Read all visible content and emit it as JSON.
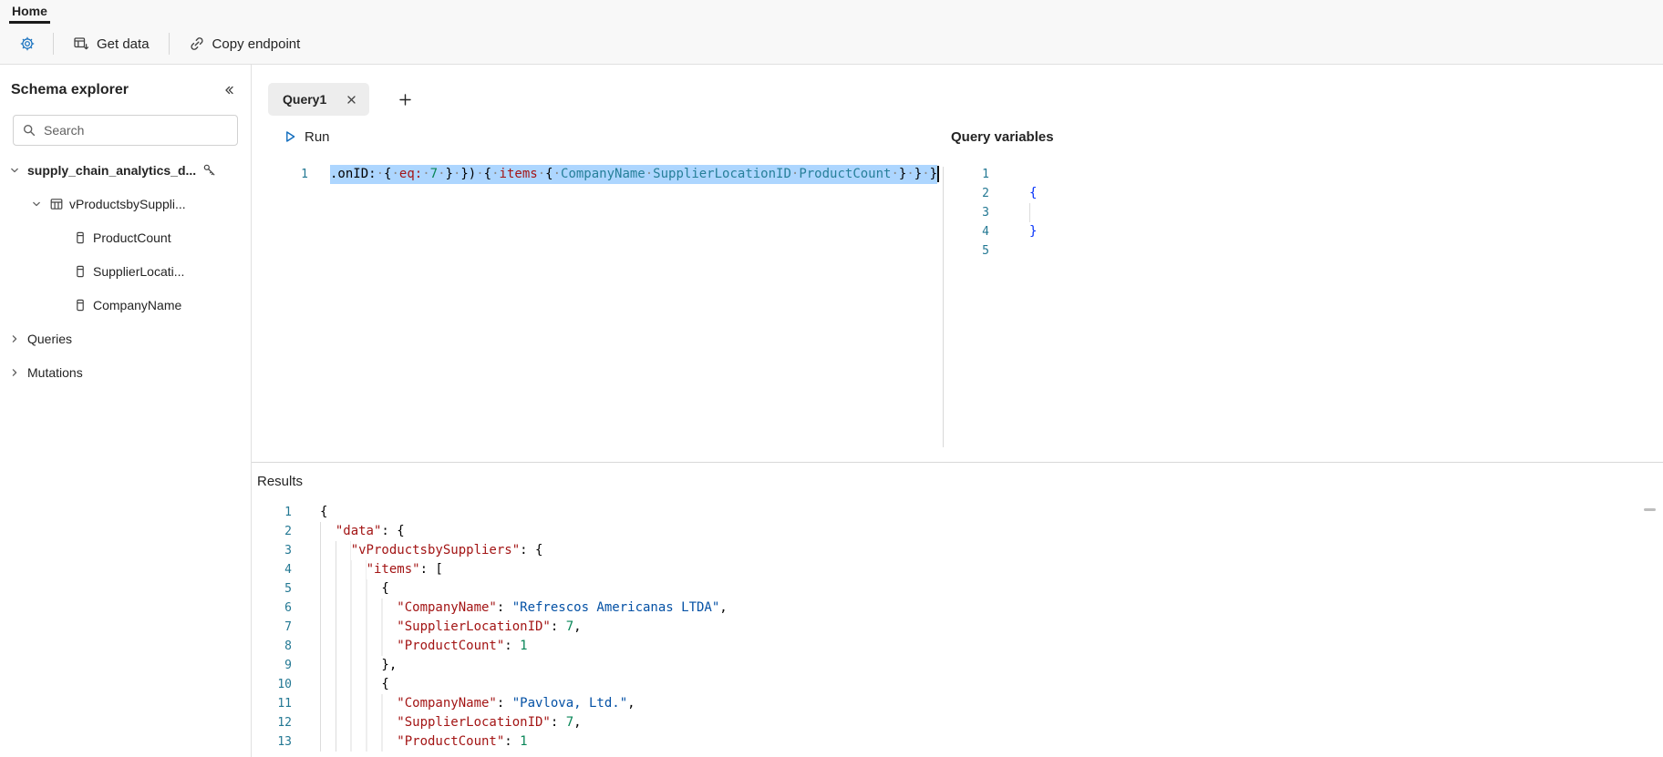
{
  "colors": {
    "accent": "#0f6cbd",
    "selection": "#add6ff",
    "gutter": "#237893",
    "token_key": "#a31515",
    "token_string": "#0451a5",
    "token_number": "#098658",
    "token_field": "#267f99",
    "token_brace": "#0431fa"
  },
  "topbar": {
    "home": "Home"
  },
  "toolbar": {
    "get_data": "Get data",
    "copy_endpoint": "Copy endpoint"
  },
  "sidebar": {
    "title": "Schema explorer",
    "search_placeholder": "Search",
    "tree": [
      {
        "label": "supply_chain_analytics_d...",
        "level": 0,
        "chevron": "down",
        "icon": "none",
        "trailing_icon": "key",
        "bold": true
      },
      {
        "label": "vProductsbySuppli...",
        "level": 1,
        "chevron": "down",
        "icon": "table"
      },
      {
        "label": "ProductCount",
        "level": 2,
        "chevron": "none",
        "icon": "column"
      },
      {
        "label": "SupplierLocati...",
        "level": 2,
        "chevron": "none",
        "icon": "column"
      },
      {
        "label": "CompanyName",
        "level": 2,
        "chevron": "none",
        "icon": "column"
      },
      {
        "label": "Queries",
        "level": 0,
        "chevron": "right",
        "icon": "none"
      },
      {
        "label": "Mutations",
        "level": 0,
        "chevron": "right",
        "icon": "none"
      }
    ]
  },
  "editor": {
    "tab_label": "Query1",
    "run_label": "Run",
    "code": {
      "line_number": 1,
      "tokens": [
        {
          "c": "plain",
          "v": ".onID:"
        },
        {
          "c": "ws",
          "v": " "
        },
        {
          "c": "punct",
          "v": "{"
        },
        {
          "c": "ws",
          "v": " "
        },
        {
          "c": "key",
          "v": "eq:"
        },
        {
          "c": "ws",
          "v": " "
        },
        {
          "c": "num",
          "v": "7"
        },
        {
          "c": "ws",
          "v": " "
        },
        {
          "c": "punct",
          "v": "}"
        },
        {
          "c": "ws",
          "v": " "
        },
        {
          "c": "punct",
          "v": "})"
        },
        {
          "c": "ws",
          "v": " "
        },
        {
          "c": "punct",
          "v": "{"
        },
        {
          "c": "ws",
          "v": " "
        },
        {
          "c": "key",
          "v": "items"
        },
        {
          "c": "ws",
          "v": " "
        },
        {
          "c": "punct",
          "v": "{"
        },
        {
          "c": "ws",
          "v": " "
        },
        {
          "c": "field",
          "v": "CompanyName"
        },
        {
          "c": "ws",
          "v": " "
        },
        {
          "c": "field",
          "v": "SupplierLocationID"
        },
        {
          "c": "ws",
          "v": " "
        },
        {
          "c": "field",
          "v": "ProductCount"
        },
        {
          "c": "ws",
          "v": " "
        },
        {
          "c": "punct",
          "v": "}"
        },
        {
          "c": "ws",
          "v": " "
        },
        {
          "c": "punct",
          "v": "}"
        },
        {
          "c": "ws",
          "v": " "
        },
        {
          "c": "punct",
          "v": "}"
        }
      ]
    },
    "variables": {
      "title": "Query variables",
      "lines": [
        {
          "n": 1,
          "text": ""
        },
        {
          "n": 2,
          "text": "{"
        },
        {
          "n": 3,
          "text": "",
          "guide": true
        },
        {
          "n": 4,
          "text": "}"
        },
        {
          "n": 5,
          "text": ""
        }
      ]
    }
  },
  "results": {
    "title": "Results",
    "lines": [
      {
        "n": 1,
        "indent": 0,
        "tokens": [
          {
            "c": "punct",
            "v": "{"
          }
        ]
      },
      {
        "n": 2,
        "indent": 2,
        "tokens": [
          {
            "c": "key",
            "v": "\"data\""
          },
          {
            "c": "punct",
            "v": ": {"
          }
        ]
      },
      {
        "n": 3,
        "indent": 4,
        "tokens": [
          {
            "c": "key",
            "v": "\"vProductsbySuppliers\""
          },
          {
            "c": "punct",
            "v": ": {"
          }
        ]
      },
      {
        "n": 4,
        "indent": 6,
        "tokens": [
          {
            "c": "key",
            "v": "\"items\""
          },
          {
            "c": "punct",
            "v": ": ["
          }
        ]
      },
      {
        "n": 5,
        "indent": 8,
        "tokens": [
          {
            "c": "punct",
            "v": "{"
          }
        ]
      },
      {
        "n": 6,
        "indent": 10,
        "tokens": [
          {
            "c": "key",
            "v": "\"CompanyName\""
          },
          {
            "c": "punct",
            "v": ": "
          },
          {
            "c": "str",
            "v": "\"Refrescos Americanas LTDA\""
          },
          {
            "c": "punct",
            "v": ","
          }
        ]
      },
      {
        "n": 7,
        "indent": 10,
        "tokens": [
          {
            "c": "key",
            "v": "\"SupplierLocationID\""
          },
          {
            "c": "punct",
            "v": ": "
          },
          {
            "c": "num",
            "v": "7"
          },
          {
            "c": "punct",
            "v": ","
          }
        ]
      },
      {
        "n": 8,
        "indent": 10,
        "tokens": [
          {
            "c": "key",
            "v": "\"ProductCount\""
          },
          {
            "c": "punct",
            "v": ": "
          },
          {
            "c": "num",
            "v": "1"
          }
        ]
      },
      {
        "n": 9,
        "indent": 8,
        "tokens": [
          {
            "c": "punct",
            "v": "},"
          }
        ]
      },
      {
        "n": 10,
        "indent": 8,
        "tokens": [
          {
            "c": "punct",
            "v": "{"
          }
        ]
      },
      {
        "n": 11,
        "indent": 10,
        "tokens": [
          {
            "c": "key",
            "v": "\"CompanyName\""
          },
          {
            "c": "punct",
            "v": ": "
          },
          {
            "c": "str",
            "v": "\"Pavlova, Ltd.\""
          },
          {
            "c": "punct",
            "v": ","
          }
        ]
      },
      {
        "n": 12,
        "indent": 10,
        "tokens": [
          {
            "c": "key",
            "v": "\"SupplierLocationID\""
          },
          {
            "c": "punct",
            "v": ": "
          },
          {
            "c": "num",
            "v": "7"
          },
          {
            "c": "punct",
            "v": ","
          }
        ]
      },
      {
        "n": 13,
        "indent": 10,
        "tokens": [
          {
            "c": "key",
            "v": "\"ProductCount\""
          },
          {
            "c": "punct",
            "v": ": "
          },
          {
            "c": "num",
            "v": "1"
          }
        ]
      }
    ]
  }
}
